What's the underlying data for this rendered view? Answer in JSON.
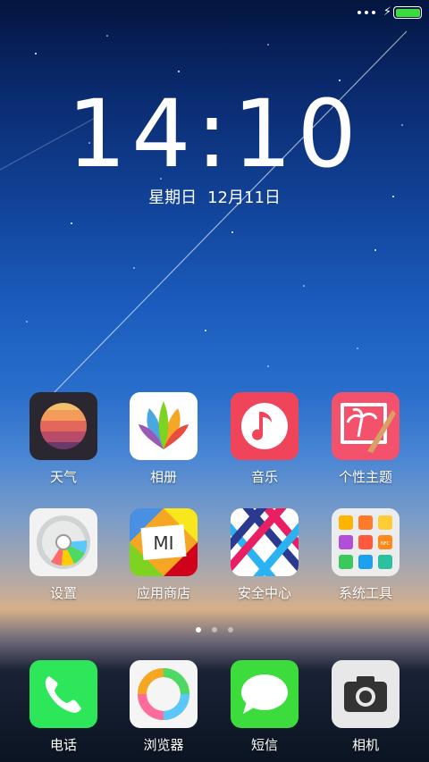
{
  "status": {
    "charge_icon": "charging-bolt",
    "battery_color": "#3ddc3d"
  },
  "clock": {
    "hours": "14",
    "minutes": "10",
    "separator": ":"
  },
  "date": {
    "weekday": "星期日",
    "day": "12月11日"
  },
  "apps_row1": [
    {
      "label": "天气",
      "icon": "weather-icon"
    },
    {
      "label": "相册",
      "icon": "gallery-icon"
    },
    {
      "label": "音乐",
      "icon": "music-icon"
    },
    {
      "label": "个性主题",
      "icon": "themes-icon"
    }
  ],
  "apps_row2": [
    {
      "label": "设置",
      "icon": "settings-icon"
    },
    {
      "label": "应用商店",
      "icon": "app-store-icon",
      "badge_text": "MI"
    },
    {
      "label": "安全中心",
      "icon": "security-icon"
    },
    {
      "label": "系统工具",
      "icon": "system-tools-folder-icon",
      "nfc_text": "NFC"
    }
  ],
  "dock": [
    {
      "label": "电话",
      "icon": "phone-icon"
    },
    {
      "label": "浏览器",
      "icon": "browser-icon"
    },
    {
      "label": "短信",
      "icon": "messages-icon"
    },
    {
      "label": "相机",
      "icon": "camera-icon"
    }
  ],
  "pager": {
    "pages": 3,
    "active": 1
  }
}
